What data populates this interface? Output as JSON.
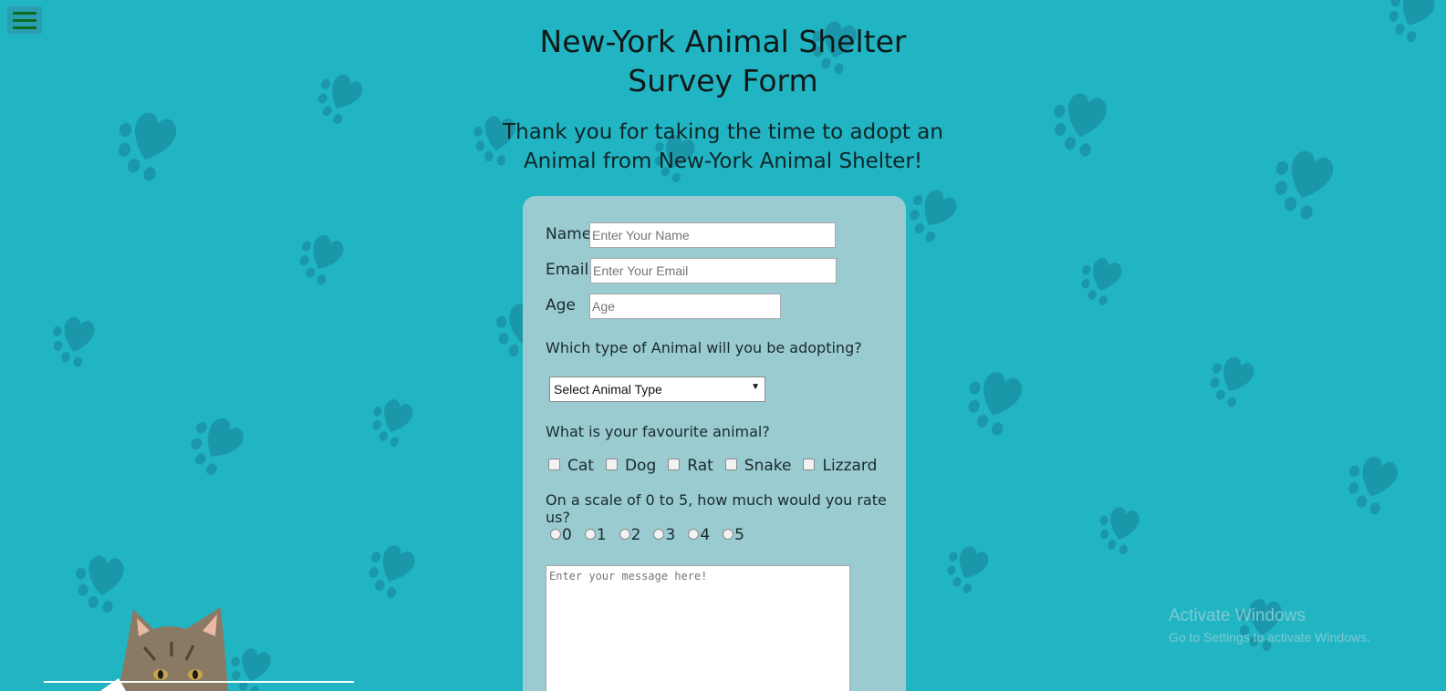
{
  "header": {
    "menu_icon": "hamburger-icon",
    "title_line1": "New-York Animal Shelter",
    "title_line2": "Survey Form",
    "subtitle_line1": "Thank you for taking the time to adopt an",
    "subtitle_line2": "Animal from New-York Animal Shelter!"
  },
  "form": {
    "name_label": "Name",
    "name_placeholder": "Enter Your Name",
    "email_label": "Email",
    "email_placeholder": "Enter Your Email",
    "age_label": "Age",
    "age_placeholder": "Age",
    "animal_type_question": "Which type of Animal will you be adopting?",
    "animal_type_selected": "Select Animal Type",
    "favourite_question": "What is your favourite animal?",
    "favourite_options": [
      "Cat",
      "Dog",
      "Rat",
      "Snake",
      "Lizzard"
    ],
    "rating_question": "On a scale of 0 to 5, how much would you rate us?",
    "rating_options": [
      "0",
      "1",
      "2",
      "3",
      "4",
      "5"
    ],
    "message_placeholder": "Enter your message here!"
  },
  "watermark": {
    "title": "Activate Windows",
    "subtitle": "Go to Settings to activate Windows."
  },
  "colors": {
    "background": "#21b5c4",
    "paw": "#1b97aa",
    "card": "#99cbd1",
    "menu_icon": "#0b6b1e"
  }
}
